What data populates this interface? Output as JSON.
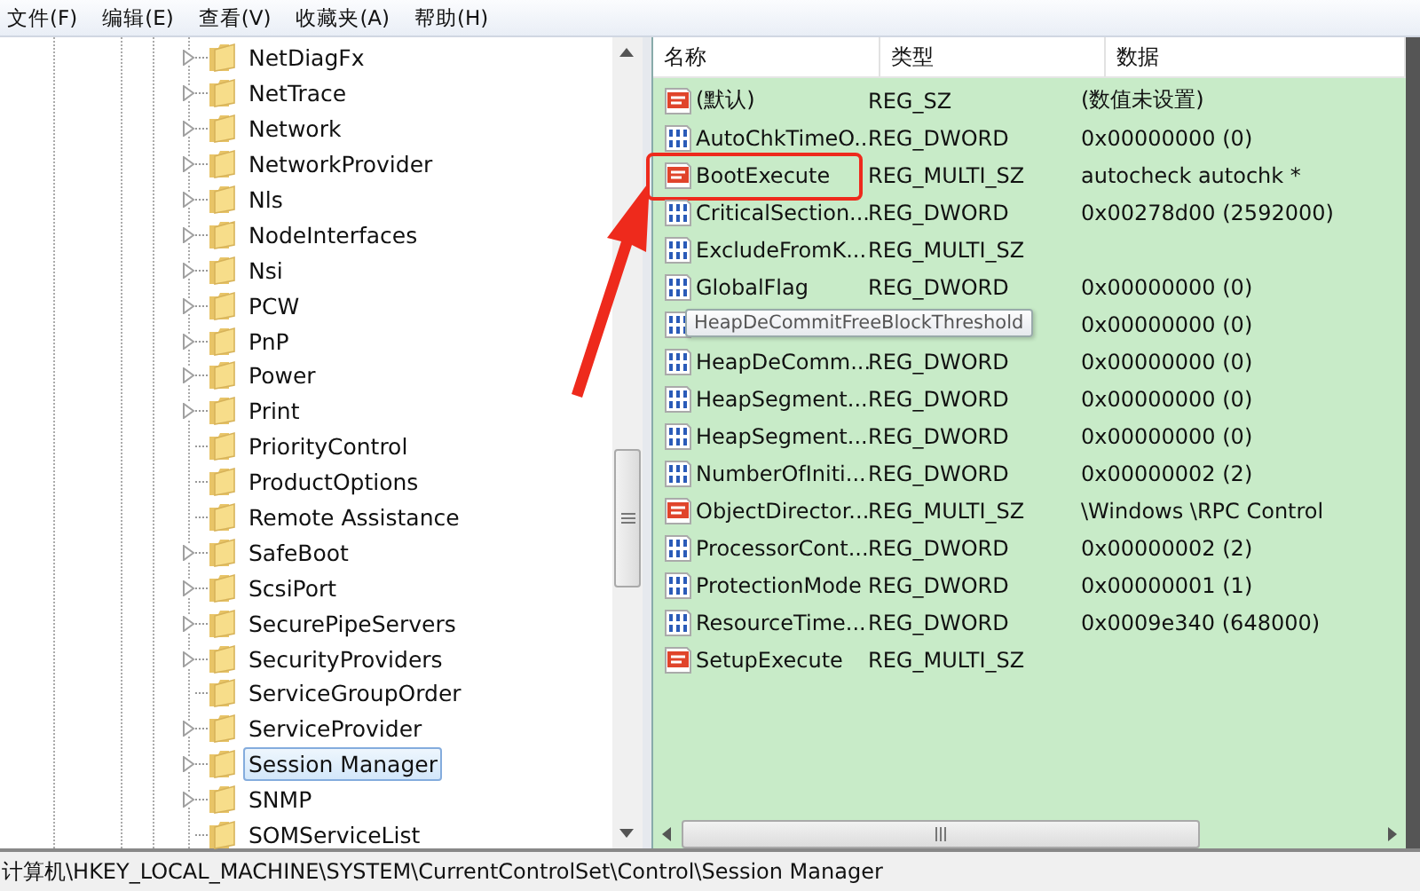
{
  "menu": [
    "文件(F)",
    "编辑(E)",
    "查看(V)",
    "收藏夹(A)",
    "帮助(H)"
  ],
  "tree": [
    {
      "label": "NetDiagFx",
      "expandable": true,
      "selected": false
    },
    {
      "label": "NetTrace",
      "expandable": true,
      "selected": false
    },
    {
      "label": "Network",
      "expandable": true,
      "selected": false
    },
    {
      "label": "NetworkProvider",
      "expandable": true,
      "selected": false
    },
    {
      "label": "Nls",
      "expandable": true,
      "selected": false
    },
    {
      "label": "NodeInterfaces",
      "expandable": true,
      "selected": false
    },
    {
      "label": "Nsi",
      "expandable": true,
      "selected": false
    },
    {
      "label": "PCW",
      "expandable": true,
      "selected": false
    },
    {
      "label": "PnP",
      "expandable": true,
      "selected": false
    },
    {
      "label": "Power",
      "expandable": true,
      "selected": false
    },
    {
      "label": "Print",
      "expandable": true,
      "selected": false
    },
    {
      "label": "PriorityControl",
      "expandable": false,
      "selected": false
    },
    {
      "label": "ProductOptions",
      "expandable": false,
      "selected": false
    },
    {
      "label": "Remote Assistance",
      "expandable": false,
      "selected": false
    },
    {
      "label": "SafeBoot",
      "expandable": true,
      "selected": false
    },
    {
      "label": "ScsiPort",
      "expandable": true,
      "selected": false
    },
    {
      "label": "SecurePipeServers",
      "expandable": true,
      "selected": false
    },
    {
      "label": "SecurityProviders",
      "expandable": true,
      "selected": false
    },
    {
      "label": "ServiceGroupOrder",
      "expandable": false,
      "selected": false
    },
    {
      "label": "ServiceProvider",
      "expandable": true,
      "selected": false
    },
    {
      "label": "Session Manager",
      "expandable": true,
      "selected": true
    },
    {
      "label": "SNMP",
      "expandable": true,
      "selected": false
    },
    {
      "label": "SOMServiceList",
      "expandable": false,
      "selected": false
    }
  ],
  "columns": [
    "名称",
    "类型",
    "数据"
  ],
  "values": [
    {
      "kind": "string",
      "name": "(默认)",
      "type": "REG_SZ",
      "data": "(数值未设置)",
      "highlighted": false
    },
    {
      "kind": "binary",
      "name": "AutoChkTimeO...",
      "type": "REG_DWORD",
      "data": "0x00000000 (0)",
      "highlighted": false
    },
    {
      "kind": "string",
      "name": "BootExecute",
      "type": "REG_MULTI_SZ",
      "data": "autocheck autochk *",
      "highlighted": true
    },
    {
      "kind": "binary",
      "name": "CriticalSection...",
      "type": "REG_DWORD",
      "data": "0x00278d00 (2592000)",
      "highlighted": false
    },
    {
      "kind": "binary",
      "name": "ExcludeFromK...",
      "type": "REG_MULTI_SZ",
      "highlighted": false
    },
    {
      "kind": "binary",
      "name": "GlobalFlag",
      "type": "REG_DWORD",
      "data": "0x00000000 (0)",
      "highlighted": false
    },
    {
      "kind": "binary",
      "tooltip": "HeapDeCommitFreeBlockThreshold",
      "data": "0x00000000 (0)",
      "highlighted": false
    },
    {
      "kind": "binary",
      "name": "HeapDeComm...",
      "type": "REG_DWORD",
      "data": "0x00000000 (0)",
      "highlighted": false
    },
    {
      "kind": "binary",
      "name": "HeapSegment...",
      "type": "REG_DWORD",
      "data": "0x00000000 (0)",
      "highlighted": false
    },
    {
      "kind": "binary",
      "name": "HeapSegment...",
      "type": "REG_DWORD",
      "data": "0x00000000 (0)",
      "highlighted": false
    },
    {
      "kind": "binary",
      "name": "NumberOfIniti...",
      "type": "REG_DWORD",
      "data": "0x00000002 (2)",
      "highlighted": false
    },
    {
      "kind": "string",
      "name": "ObjectDirector...",
      "type": "REG_MULTI_SZ",
      "data": "\\Windows \\RPC Control",
      "highlighted": false
    },
    {
      "kind": "binary",
      "name": "ProcessorCont...",
      "type": "REG_DWORD",
      "data": "0x00000002 (2)",
      "highlighted": false
    },
    {
      "kind": "binary",
      "name": "ProtectionMode",
      "type": "REG_DWORD",
      "data": "0x00000001 (1)",
      "highlighted": false
    },
    {
      "kind": "binary",
      "name": "ResourceTime...",
      "type": "REG_DWORD",
      "data": "0x0009e340 (648000)",
      "highlighted": false
    },
    {
      "kind": "string",
      "name": "SetupExecute",
      "type": "REG_MULTI_SZ",
      "highlighted": false
    }
  ],
  "status_bar": "计算机\\HKEY_LOCAL_MACHINE\\SYSTEM\\CurrentControlSet\\Control\\Session Manager"
}
